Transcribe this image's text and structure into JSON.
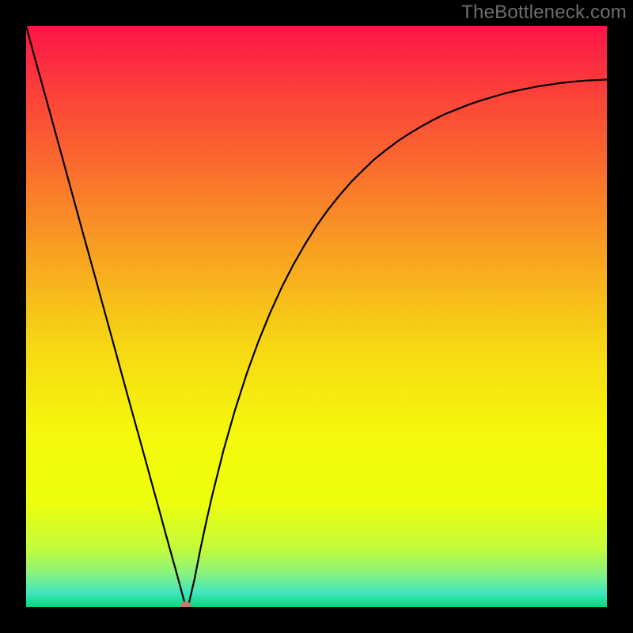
{
  "watermark": "TheBottleneck.com",
  "chart_data": {
    "type": "line",
    "title": "",
    "xlabel": "",
    "ylabel": "",
    "xlim": [
      0,
      100
    ],
    "ylim": [
      0,
      100
    ],
    "series": [
      {
        "name": "curve",
        "color": "#000000",
        "x": [
          0,
          2,
          4,
          6,
          8,
          10,
          12,
          14,
          16,
          18,
          20,
          22,
          23,
          24,
          25,
          26,
          27,
          27.5,
          28,
          29,
          30,
          31,
          32,
          34,
          36,
          38,
          40,
          42,
          44,
          46,
          48,
          50,
          52,
          54,
          56,
          58,
          60,
          62,
          64,
          66,
          68,
          70,
          72,
          74,
          76,
          78,
          80,
          82,
          84,
          86,
          88,
          90,
          92,
          94,
          96,
          98,
          100
        ],
        "y": [
          100,
          92.7,
          85.5,
          78.2,
          70.9,
          63.6,
          56.4,
          49.1,
          41.8,
          34.5,
          27.3,
          20,
          16.4,
          12.7,
          9.1,
          5.5,
          1.8,
          0,
          0.5,
          4.8,
          9.9,
          14.6,
          19,
          27,
          34,
          40.2,
          45.7,
          50.6,
          55,
          58.9,
          62.4,
          65.6,
          68.4,
          70.9,
          73.2,
          75.2,
          77.1,
          78.7,
          80.2,
          81.5,
          82.7,
          83.8,
          84.8,
          85.6,
          86.4,
          87.1,
          87.7,
          88.3,
          88.8,
          89.2,
          89.6,
          89.9,
          90.2,
          90.4,
          90.6,
          90.7,
          90.8
        ]
      }
    ],
    "marker": {
      "x": 27.5,
      "y": 0,
      "color": "#c8786a",
      "radius": 7
    },
    "gradient_stops": [
      {
        "offset": 0.0,
        "color": "#fd1449"
      },
      {
        "offset": 0.1,
        "color": "#fc3b3b"
      },
      {
        "offset": 0.25,
        "color": "#fa6f2d"
      },
      {
        "offset": 0.4,
        "color": "#f8a520"
      },
      {
        "offset": 0.55,
        "color": "#f6d714"
      },
      {
        "offset": 0.7,
        "color": "#f5f80c"
      },
      {
        "offset": 0.82,
        "color": "#edfe0c"
      },
      {
        "offset": 0.9,
        "color": "#c3fb3c"
      },
      {
        "offset": 0.94,
        "color": "#8cf37a"
      },
      {
        "offset": 0.975,
        "color": "#43e5bf"
      },
      {
        "offset": 1.0,
        "color": "#03da7f"
      }
    ],
    "annotations": []
  }
}
